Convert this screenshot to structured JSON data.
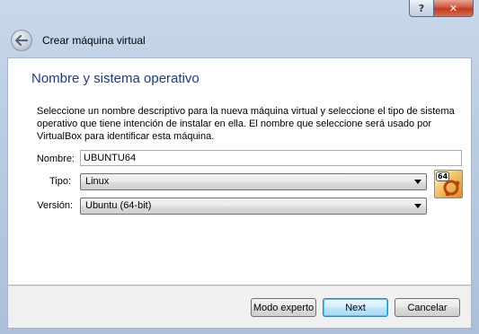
{
  "window": {
    "help_glyph": "?",
    "close_glyph": "✕"
  },
  "header": {
    "title": "Crear máquina virtual"
  },
  "panel": {
    "heading": "Nombre y sistema operativo",
    "description": "Seleccione un nombre descriptivo para la nueva máquina virtual y seleccione el tipo de sistema operativo que tiene intención de instalar en ella. El nombre que seleccione será usado por VirtualBox para identificar esta máquina.",
    "name_label": "Nombre:",
    "name_value": "UBUNTU64",
    "type_label": "Tipo:",
    "type_value": "Linux",
    "version_label": "Versión:",
    "version_value": "Ubuntu (64-bit)",
    "os_icon_badge": "64"
  },
  "buttons": {
    "expert": "Modo experto",
    "next": "Next",
    "cancel": "Cancelar"
  },
  "colors": {
    "heading": "#1e3a8c",
    "default_button_border": "#3c7fb1"
  }
}
